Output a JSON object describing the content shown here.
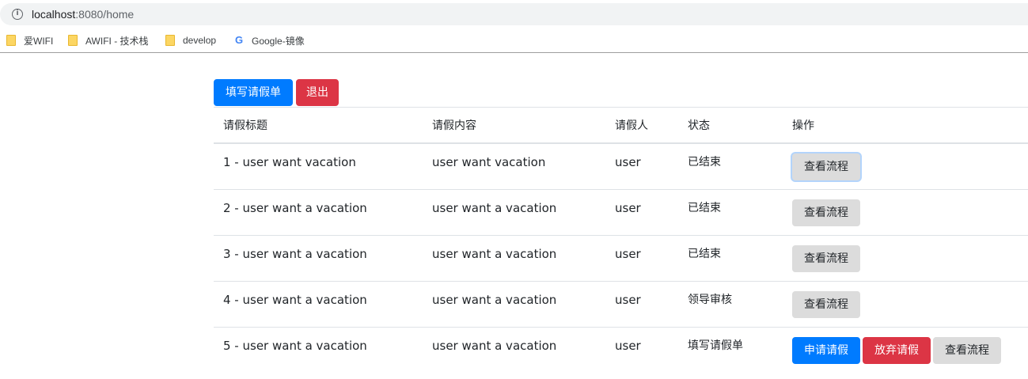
{
  "browser": {
    "url_host": "localhost",
    "url_rest": ":8080/home",
    "bookmarks": [
      {
        "label": "爱WIFI",
        "icon": "folder-icon"
      },
      {
        "label": "AWIFI - 技术栈",
        "icon": "folder-icon"
      },
      {
        "label": "develop",
        "icon": "folder-icon"
      },
      {
        "label": "Google-镜像",
        "icon": "google-icon"
      }
    ]
  },
  "toolbar": {
    "fill_form_label": "填写请假单",
    "logout_label": "退出"
  },
  "table": {
    "headers": [
      "请假标题",
      "请假内容",
      "请假人",
      "状态",
      "操作"
    ],
    "rows": [
      {
        "title": "1 - user want vacation",
        "content": "user want vacation",
        "applicant": "user",
        "status": "已结束",
        "actions": [
          "查看流程"
        ]
      },
      {
        "title": "2 - user want a vacation",
        "content": "user want a vacation",
        "applicant": "user",
        "status": "已结束",
        "actions": [
          "查看流程"
        ]
      },
      {
        "title": "3 - user want a vacation",
        "content": "user want a vacation",
        "applicant": "user",
        "status": "已结束",
        "actions": [
          "查看流程"
        ]
      },
      {
        "title": "4 - user want a vacation",
        "content": "user want a vacation",
        "applicant": "user",
        "status": "领导审核",
        "actions": [
          "查看流程"
        ]
      },
      {
        "title": "5 - user want a vacation",
        "content": "user want a vacation",
        "applicant": "user",
        "status": "填写请假单",
        "actions": [
          "申请请假",
          "放弃请假",
          "查看流程"
        ]
      }
    ]
  },
  "colors": {
    "primary": "#007bff",
    "danger": "#dc3545",
    "light": "#dcdcdc",
    "border": "#dee2e6"
  }
}
